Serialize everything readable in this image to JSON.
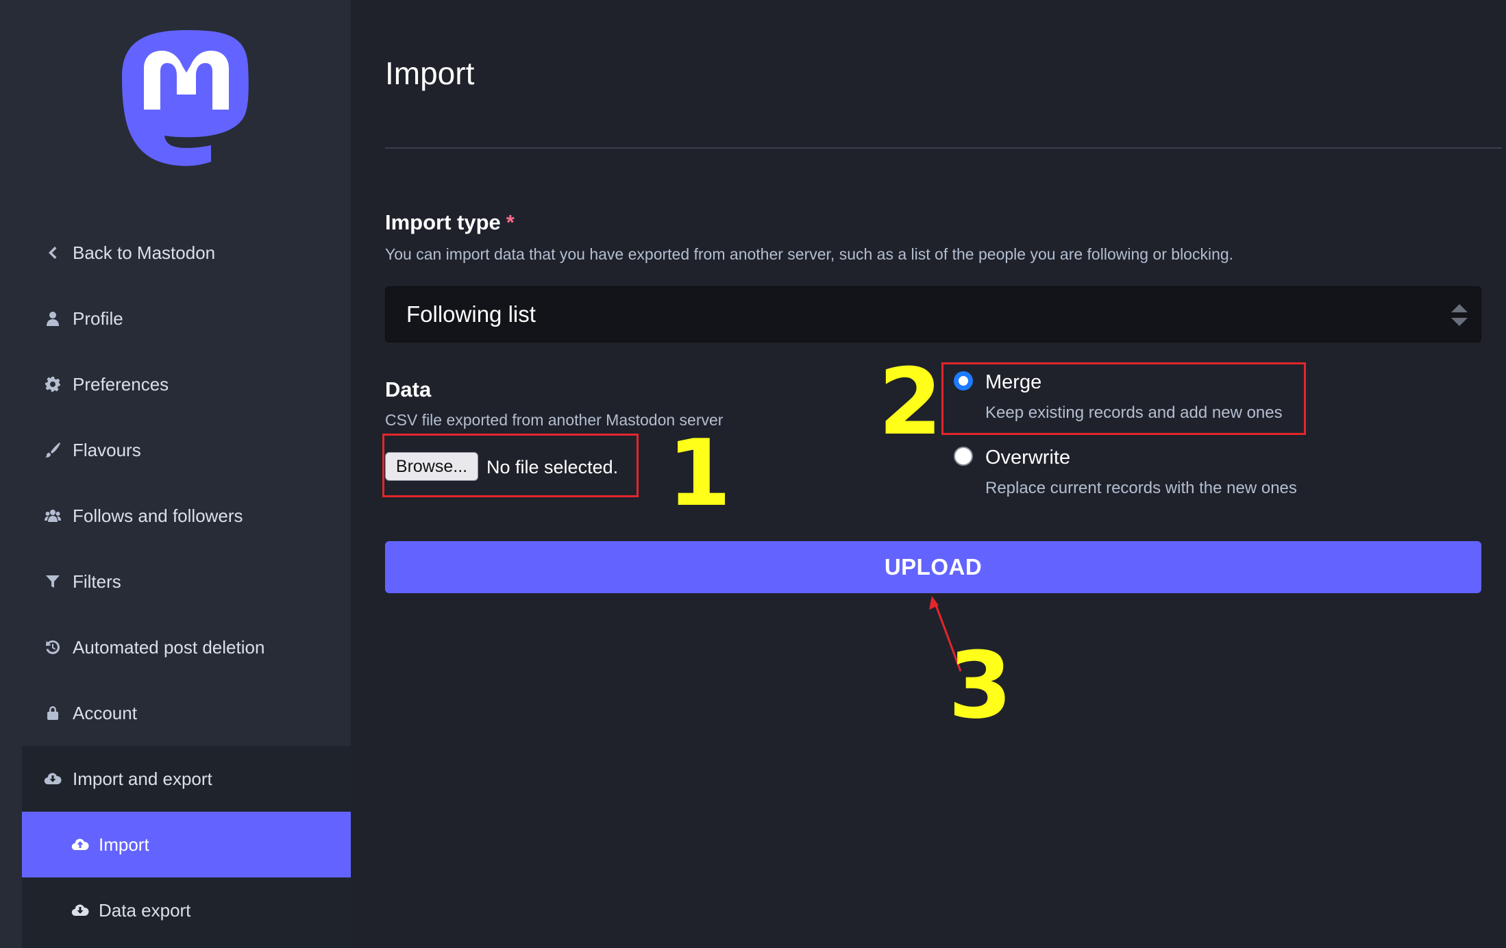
{
  "sidebar": {
    "logo_icon": "mastodon-logo-icon",
    "items": [
      {
        "label": "Back to Mastodon",
        "icon": "chevron-left-icon"
      },
      {
        "label": "Profile",
        "icon": "user-icon"
      },
      {
        "label": "Preferences",
        "icon": "gear-icon"
      },
      {
        "label": "Flavours",
        "icon": "paintbrush-icon"
      },
      {
        "label": "Follows and followers",
        "icon": "users-icon"
      },
      {
        "label": "Filters",
        "icon": "filter-icon"
      },
      {
        "label": "Automated post deletion",
        "icon": "history-icon"
      },
      {
        "label": "Account",
        "icon": "lock-icon"
      }
    ],
    "group": {
      "label": "Import and export",
      "icon": "cloud-download-icon",
      "children": [
        {
          "label": "Import",
          "icon": "cloud-upload-icon",
          "active": true
        },
        {
          "label": "Data export",
          "icon": "cloud-download-icon",
          "active": false
        }
      ]
    }
  },
  "main": {
    "title": "Import",
    "import_type": {
      "label": "Import type",
      "required_mark": "*",
      "hint": "You can import data that you have exported from another server, such as a list of the people you are following or blocking.",
      "selected": "Following list"
    },
    "data": {
      "label": "Data",
      "hint": "CSV file exported from another Mastodon server",
      "browse_label": "Browse...",
      "file_status": "No file selected."
    },
    "mode": {
      "options": [
        {
          "label": "Merge",
          "hint": "Keep existing records and add new ones",
          "checked": true
        },
        {
          "label": "Overwrite",
          "hint": "Replace current records with the new ones",
          "checked": false
        }
      ]
    },
    "upload_label": "UPLOAD"
  },
  "annotations": {
    "step1": "1",
    "step2": "2",
    "step3": "3",
    "highlight_color": "#e3262c",
    "number_color": "#ffff1a"
  },
  "colors": {
    "accent": "#6364ff",
    "sidebar_bg": "#282c37",
    "main_bg": "#1f222b"
  }
}
